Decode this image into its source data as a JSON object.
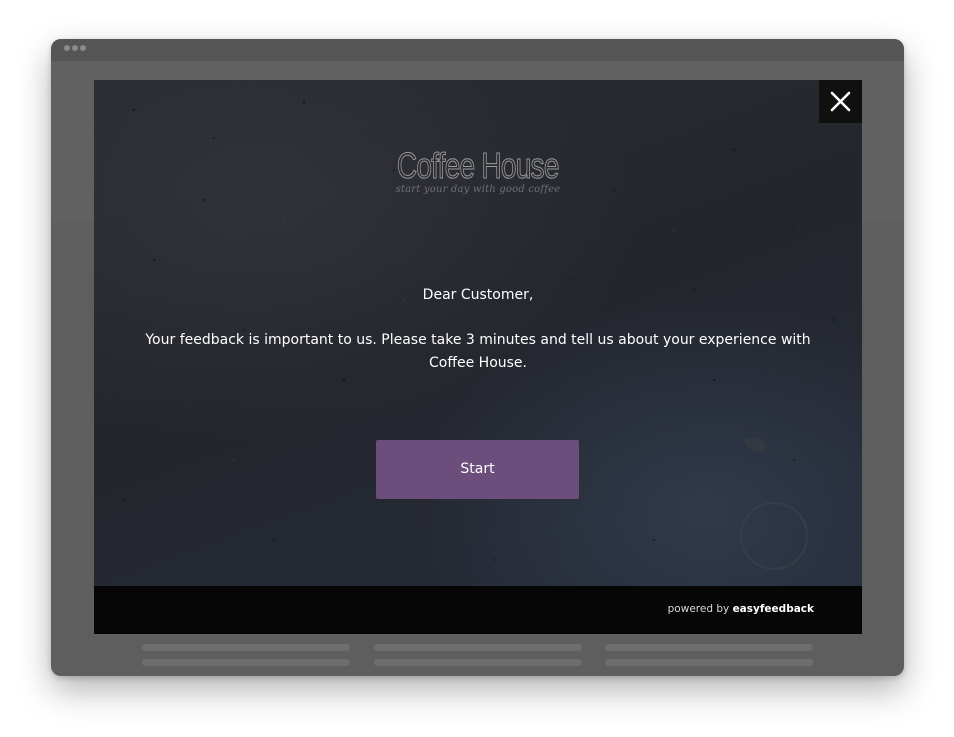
{
  "logo": {
    "title": "Coffee House",
    "tagline": "start your day with good coffee"
  },
  "survey": {
    "greeting": "Dear Customer,",
    "message": "Your feedback is important to us. Please take 3 minutes and tell us about your experience with Coffee House.",
    "start_label": "Start"
  },
  "footer": {
    "powered_prefix": "powered by",
    "brand": "easyfeedback"
  },
  "icons": {
    "close": "close-icon"
  },
  "colors": {
    "start_button": "#6c4d7c",
    "modal_background": "#26282e",
    "footer_background": "#060606",
    "window_frame": "#5e5e5e"
  }
}
